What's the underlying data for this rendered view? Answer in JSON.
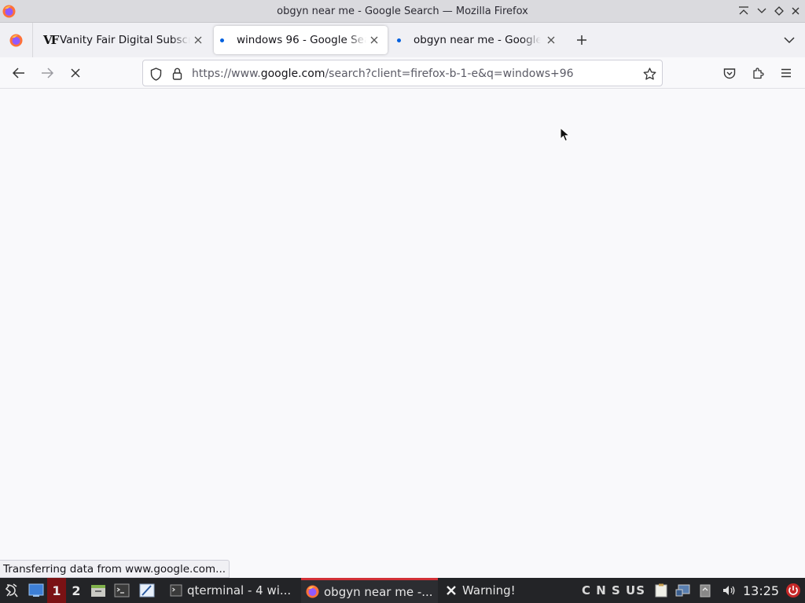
{
  "window": {
    "title": "obgyn near me - Google Search — Mozilla Firefox"
  },
  "tabs": [
    {
      "title": "Vanity Fair Digital Subscription",
      "favicon": "VF",
      "active": false,
      "loading": false
    },
    {
      "title": "windows 96 - Google Search",
      "active": true,
      "loading": true
    },
    {
      "title": "obgyn near me - Google Search",
      "active": false,
      "loading": true
    }
  ],
  "navbar": {
    "url_prefix": "https://www.",
    "url_host": "google.com",
    "url_path": "/search?client=firefox-b-1-e&q=windows+96"
  },
  "status": {
    "text": "Transferring data from www.google.com..."
  },
  "taskbar": {
    "workspaces": [
      "1",
      "2"
    ],
    "tasks": [
      {
        "label": "qterminal - 4 wi...",
        "icon": "terminal-icon",
        "active": false
      },
      {
        "label": "obgyn near me -...",
        "icon": "firefox-icon",
        "active": true
      },
      {
        "label": "Warning!",
        "icon": "x-icon",
        "active": false
      }
    ],
    "indicators": "C N S US",
    "clock": "13:25"
  },
  "colors": {
    "accent": "#0060df",
    "taskbar_bg": "#232427",
    "active_workspace": "#7a1214",
    "active_task_border": "#d23036"
  }
}
